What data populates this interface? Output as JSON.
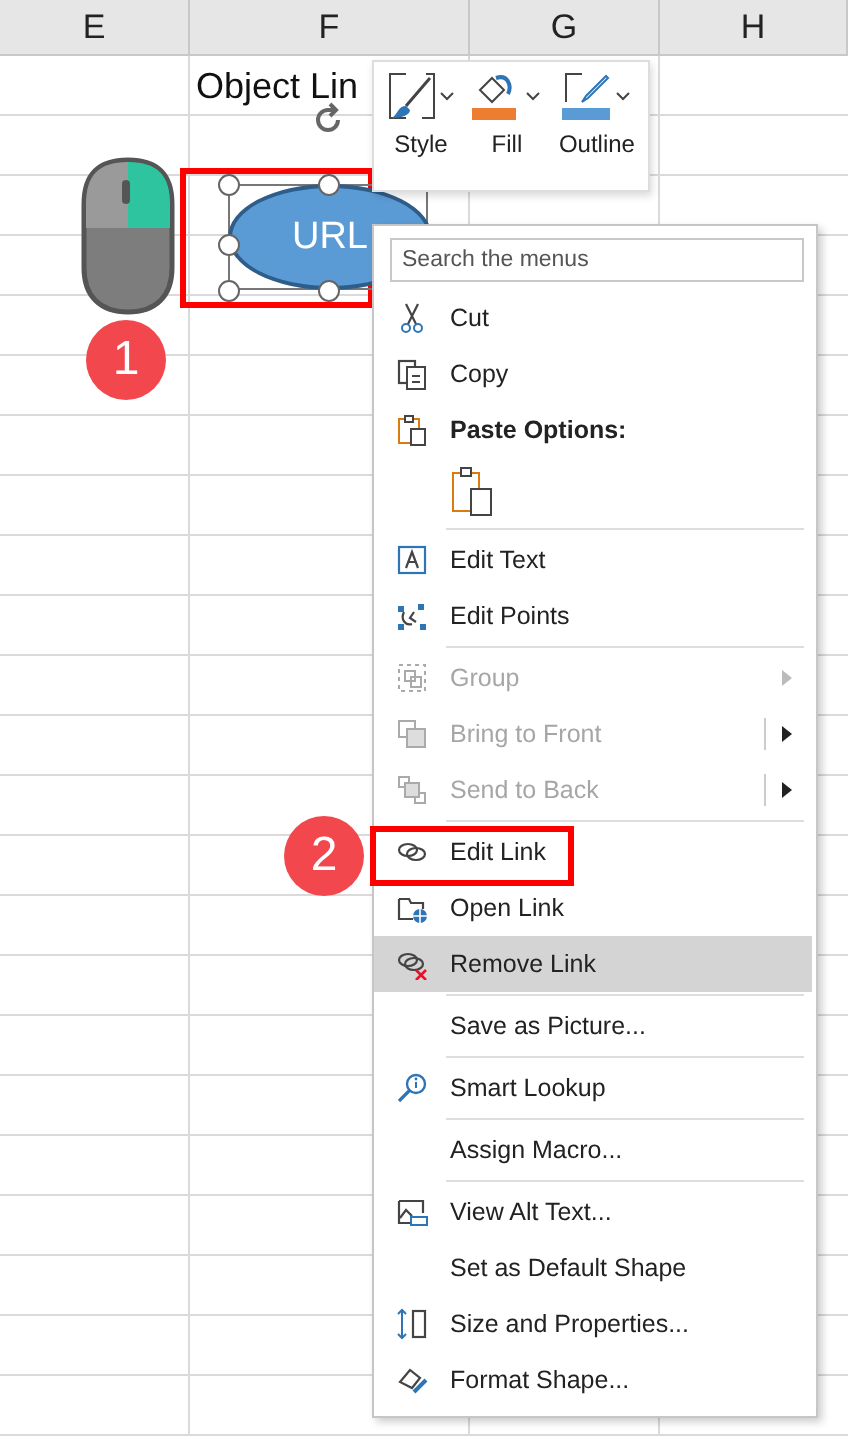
{
  "sheet": {
    "columns": [
      {
        "label": "E"
      },
      {
        "label": "F"
      },
      {
        "label": "G"
      },
      {
        "label": "H"
      }
    ],
    "cell_text": "Object Lin"
  },
  "shape": {
    "label": "URL",
    "selected": true
  },
  "badges": [
    {
      "label": "1"
    },
    {
      "label": "2"
    }
  ],
  "mini_toolbar": {
    "buttons": [
      {
        "label": "Style"
      },
      {
        "label": "Fill",
        "color": "#ed7d31"
      },
      {
        "label": "Outline",
        "color": "#5b9bd5"
      }
    ]
  },
  "context_menu": {
    "search": {
      "placeholder": "Search the menus"
    },
    "items": [
      {
        "kind": "item",
        "label": "Cut",
        "disabled": false,
        "selected": false
      },
      {
        "kind": "item",
        "label": "Copy",
        "disabled": false,
        "selected": false
      },
      {
        "kind": "header",
        "label": "Paste Options:"
      },
      {
        "kind": "paste"
      },
      {
        "kind": "separator"
      },
      {
        "kind": "item",
        "label": "Edit Text",
        "disabled": false,
        "selected": false
      },
      {
        "kind": "item",
        "label": "Edit Points",
        "disabled": false,
        "selected": false
      },
      {
        "kind": "separator"
      },
      {
        "kind": "item",
        "label": "Group",
        "disabled": true,
        "selected": false,
        "submenu": true,
        "split": false
      },
      {
        "kind": "item",
        "label": "Bring to Front",
        "disabled": true,
        "selected": false,
        "submenu": true,
        "split": true
      },
      {
        "kind": "item",
        "label": "Send to Back",
        "disabled": true,
        "selected": false,
        "submenu": true,
        "split": true
      },
      {
        "kind": "separator"
      },
      {
        "kind": "item",
        "label": "Edit Link",
        "disabled": false,
        "selected": false
      },
      {
        "kind": "item",
        "label": "Open Link",
        "disabled": false,
        "selected": false
      },
      {
        "kind": "item",
        "label": "Remove Link",
        "disabled": false,
        "selected": true
      },
      {
        "kind": "separator"
      },
      {
        "kind": "item",
        "label": "Save as Picture...",
        "disabled": false,
        "selected": false
      },
      {
        "kind": "separator"
      },
      {
        "kind": "item",
        "label": "Smart Lookup",
        "disabled": false,
        "selected": false
      },
      {
        "kind": "separator"
      },
      {
        "kind": "item",
        "label": "Assign Macro...",
        "disabled": false,
        "selected": false
      },
      {
        "kind": "separator"
      },
      {
        "kind": "item",
        "label": "View Alt Text...",
        "disabled": false,
        "selected": false
      },
      {
        "kind": "item",
        "label": "Set as Default Shape",
        "disabled": false,
        "selected": false
      },
      {
        "kind": "item",
        "label": "Size and Properties...",
        "disabled": false,
        "selected": false
      },
      {
        "kind": "item",
        "label": "Format Shape...",
        "disabled": false,
        "selected": false
      }
    ]
  }
}
